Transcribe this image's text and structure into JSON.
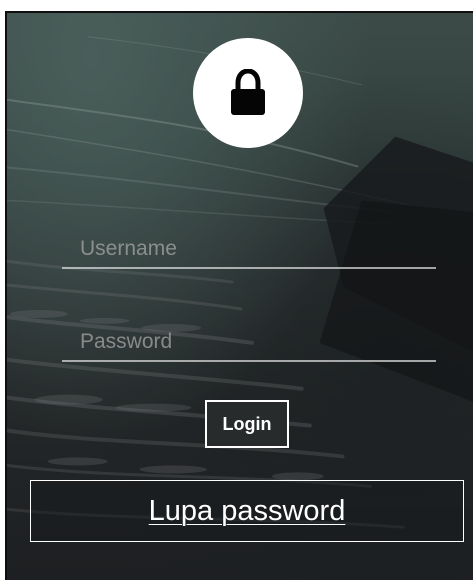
{
  "login_form": {
    "username_placeholder": "Username",
    "password_placeholder": "Password",
    "login_label": "Login",
    "forgot_password_label": "Lupa password"
  },
  "icons": {
    "lock": "lock-icon"
  },
  "colors": {
    "overlay_top": "#3c4b48",
    "overlay_bottom": "#1d1f22",
    "foreground": "#ffffff"
  }
}
